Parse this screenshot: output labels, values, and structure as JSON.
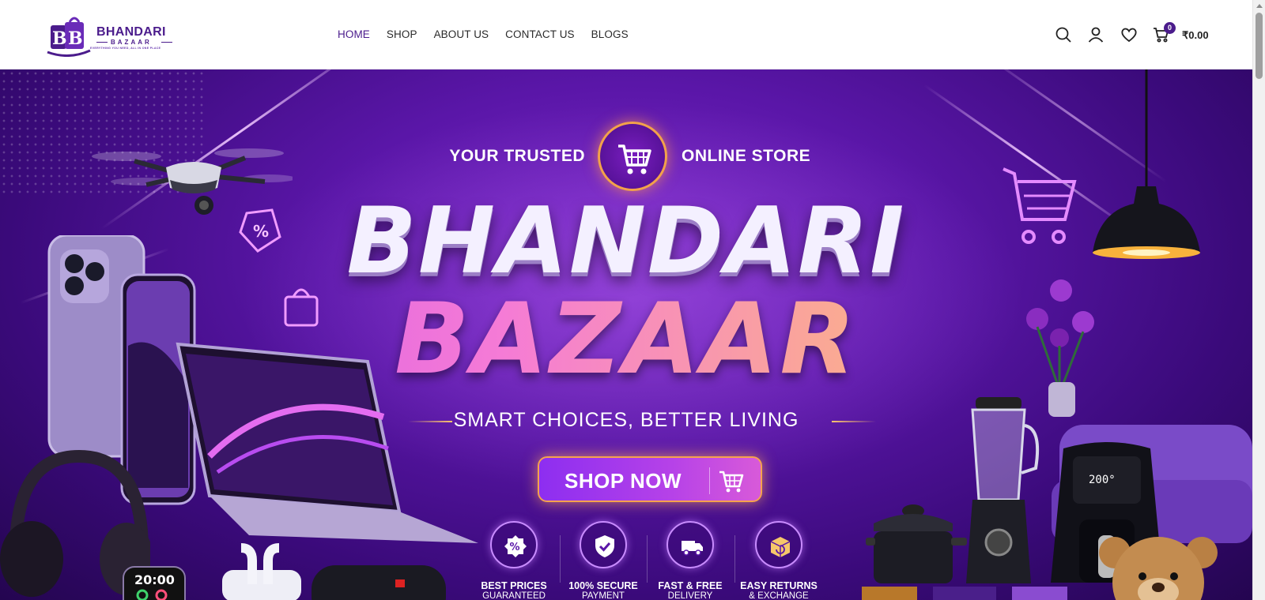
{
  "header": {
    "logo": {
      "title": "BHANDARI",
      "subtitle": "BAZAAR",
      "tagline": "EVERYTHING YOU NEED, ALL IN ONE PLACE"
    },
    "nav": [
      {
        "label": "HOME",
        "active": true
      },
      {
        "label": "SHOP",
        "active": false
      },
      {
        "label": "ABOUT US",
        "active": false
      },
      {
        "label": "CONTACT US",
        "active": false
      },
      {
        "label": "BLOGS",
        "active": false
      }
    ],
    "tools": {
      "icons": [
        "search-icon",
        "user-icon",
        "heart-icon",
        "cart-icon"
      ],
      "cart_count": "0",
      "cart_total": "₹0.00"
    }
  },
  "hero": {
    "tagline_left": "YOUR TRUSTED",
    "tagline_right": "ONLINE STORE",
    "title_line1": "BHANDARI",
    "title_line2": "BAZAAR",
    "slogan": "SMART CHOICES, BETTER LIVING",
    "cta_label": "SHOP NOW",
    "features": [
      {
        "line1": "BEST PRICES",
        "line2": "GUARANTEED",
        "icon": "percent-badge-icon"
      },
      {
        "line1": "100% SECURE",
        "line2": "PAYMENT",
        "icon": "shield-check-icon"
      },
      {
        "line1": "FAST & FREE",
        "line2": "DELIVERY",
        "icon": "truck-icon"
      },
      {
        "line1": "EASY RETURNS",
        "line2": "& EXCHANGE",
        "icon": "return-box-icon"
      }
    ],
    "product_art": {
      "watch_time": "20:00",
      "airfryer_display": "200°"
    }
  },
  "colors": {
    "brand": "#4b1c8c",
    "hero_bg": "#5a16a8",
    "accent_orange": "#f6a24d"
  }
}
